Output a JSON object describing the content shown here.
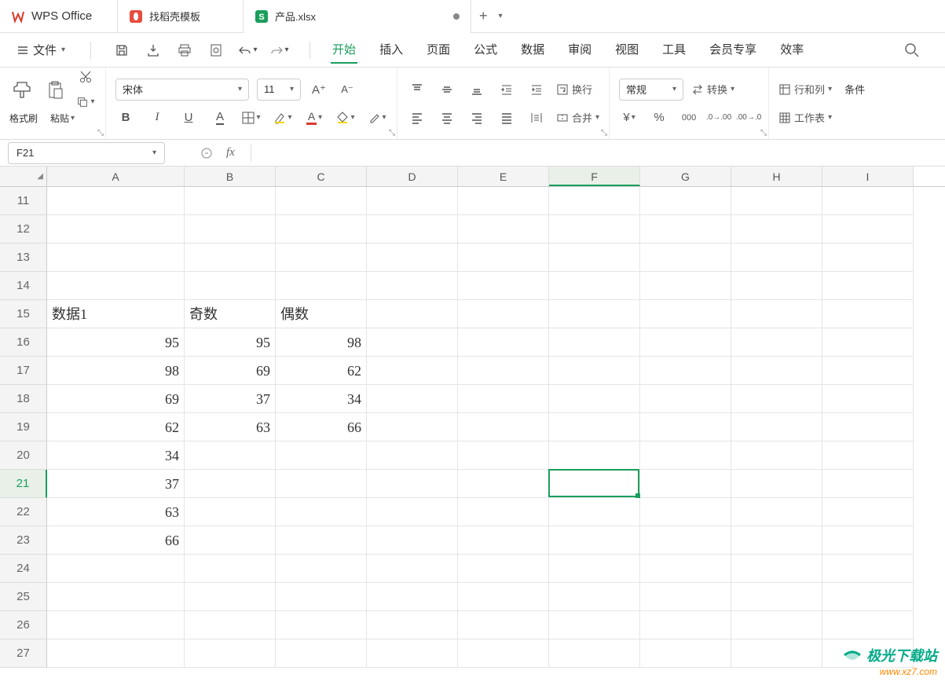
{
  "app": {
    "name": "WPS Office"
  },
  "tabs": [
    {
      "icon": "wps",
      "label": "WPS Office"
    },
    {
      "icon": "docer",
      "label": "找稻壳模板"
    },
    {
      "icon": "sheet",
      "label": "产品.xlsx",
      "modified": true,
      "active": true
    }
  ],
  "file_menu": "文件",
  "menu_items": [
    "开始",
    "插入",
    "页面",
    "公式",
    "数据",
    "审阅",
    "视图",
    "工具",
    "会员专享",
    "效率"
  ],
  "active_menu": "开始",
  "ribbon": {
    "format_painter": "格式刷",
    "paste": "粘贴",
    "font_name": "宋体",
    "font_size": "11",
    "wrap": "换行",
    "merge": "合并",
    "number_format": "常规",
    "convert": "转换",
    "rows_cols": "行和列",
    "worksheet": "工作表",
    "conditional": "条件"
  },
  "namebox": "F21",
  "formula": "",
  "columns": [
    "A",
    "B",
    "C",
    "D",
    "E",
    "F",
    "G",
    "H",
    "I"
  ],
  "selected_col": "F",
  "row_start": 11,
  "row_end": 27,
  "selected_row": 21,
  "selected_cell": "F21",
  "sheet_data": {
    "15": {
      "A": "数据1",
      "B": "奇数",
      "C": "偶数"
    },
    "16": {
      "A": 95,
      "B": 95,
      "C": 98
    },
    "17": {
      "A": 98,
      "B": 69,
      "C": 62
    },
    "18": {
      "A": 69,
      "B": 37,
      "C": 34
    },
    "19": {
      "A": 62,
      "B": 63,
      "C": 66
    },
    "20": {
      "A": 34
    },
    "21": {
      "A": 37
    },
    "22": {
      "A": 63
    },
    "23": {
      "A": 66
    }
  },
  "watermark": {
    "line1": "极光下载站",
    "line2": "www.xz7.com"
  }
}
